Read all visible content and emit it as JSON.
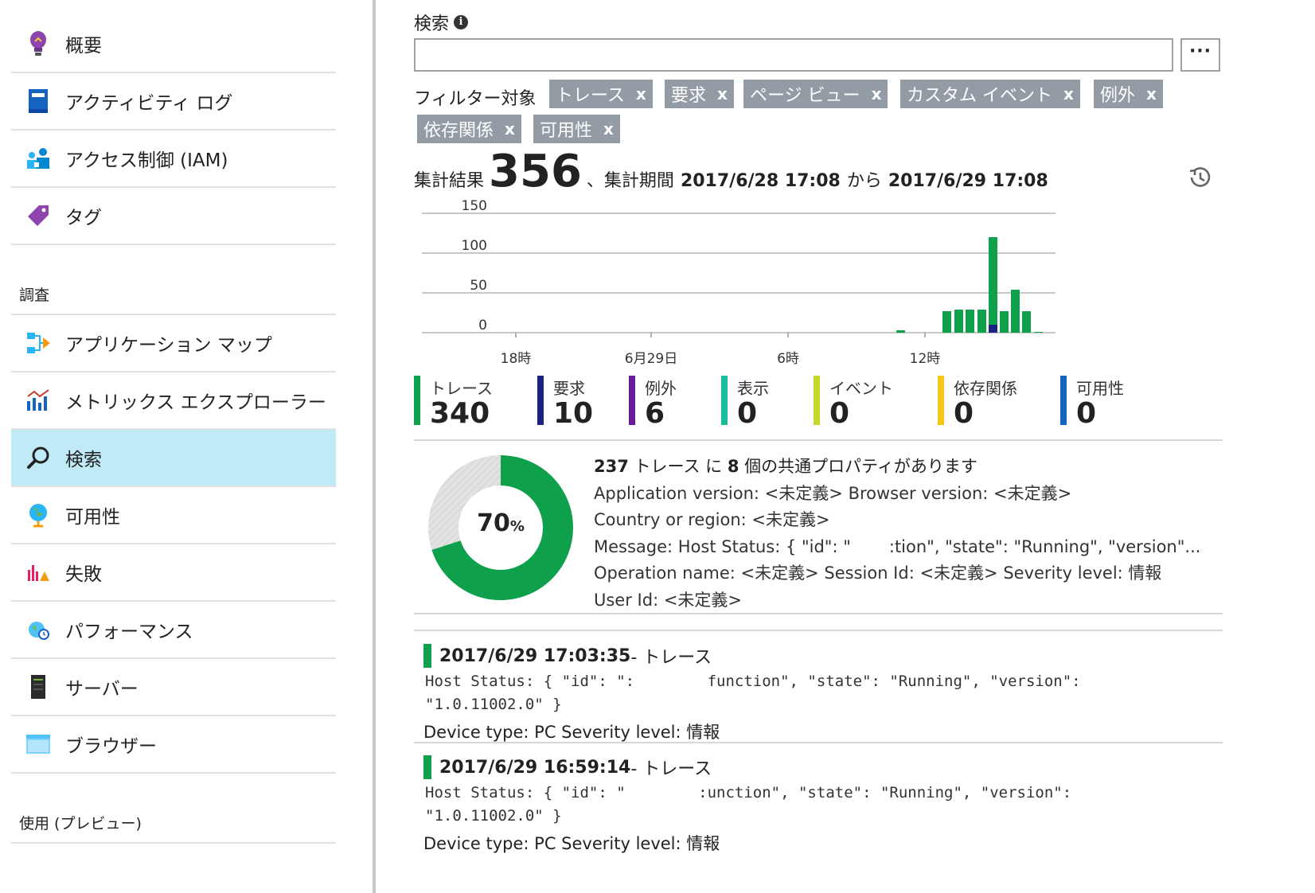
{
  "sidebar": {
    "items_top": [
      {
        "label": "概要",
        "icon": "lightbulb-icon"
      },
      {
        "label": "アクティビティ ログ",
        "icon": "activity-log-icon"
      },
      {
        "label": "アクセス制御 (IAM)",
        "icon": "iam-users-icon"
      },
      {
        "label": "タグ",
        "icon": "tag-icon"
      }
    ],
    "section_investigate": "調査",
    "items_investigate": [
      {
        "label": "アプリケーション マップ",
        "icon": "app-map-icon"
      },
      {
        "label": "メトリックス エクスプローラー",
        "icon": "metrics-chart-icon"
      },
      {
        "label": "検索",
        "icon": "search-icon",
        "active": true
      },
      {
        "label": "可用性",
        "icon": "globe-icon"
      },
      {
        "label": "失敗",
        "icon": "failures-icon"
      },
      {
        "label": "パフォーマンス",
        "icon": "performance-icon"
      },
      {
        "label": "サーバー",
        "icon": "server-icon"
      },
      {
        "label": "ブラウザー",
        "icon": "browser-icon"
      }
    ],
    "section_usage": "使用 (プレビュー)"
  },
  "search": {
    "label": "検索",
    "info_icon": "i",
    "value": "",
    "placeholder": "",
    "more_label": "···"
  },
  "filter": {
    "label": "フィルター対象",
    "chips": [
      "トレース",
      "要求",
      "ページ ビュー",
      "カスタム イベント",
      "例外",
      "依存関係",
      "可用性"
    ],
    "remove_glyph": "x"
  },
  "summary": {
    "prefix": "集計結果",
    "total": "356",
    "period_prefix": "、集計期間",
    "from": "2017/6/28 17:08",
    "mid": "から",
    "to": "2017/6/29 17:08"
  },
  "chart_data": {
    "type": "bar",
    "y_ticks": [
      "150",
      "100",
      "50",
      "0"
    ],
    "ylim": [
      0,
      150
    ],
    "x_ticks": [
      "18時",
      "6月29日",
      "6時",
      "12時"
    ],
    "grid": true,
    "colors": {
      "traces": "#0ea04a",
      "requests": "#1a237e"
    },
    "series": [
      {
        "name": "トレース",
        "values": [
          3,
          0,
          0,
          27,
          29,
          29,
          29,
          110,
          27,
          54,
          27,
          1
        ]
      },
      {
        "name": "要求",
        "values": [
          0,
          0,
          0,
          0,
          0,
          0,
          0,
          10,
          0,
          0,
          0,
          0
        ]
      }
    ]
  },
  "counts": [
    {
      "label": "トレース",
      "value": "340",
      "color": "#0ea04a"
    },
    {
      "label": "要求",
      "value": "10",
      "color": "#1a237e"
    },
    {
      "label": "例外",
      "value": "6",
      "color": "#6a1b9a"
    },
    {
      "label": "表示",
      "value": "0",
      "color": "#1abc9c"
    },
    {
      "label": "イベント",
      "value": "0",
      "color": "#c6d62a"
    },
    {
      "label": "依存関係",
      "value": "0",
      "color": "#f5c518"
    },
    {
      "label": "可用性",
      "value": "0",
      "color": "#1565c0"
    }
  ],
  "common": {
    "percent": 70,
    "percent_label": "70",
    "percent_unit": "%",
    "count": "237",
    "entity": "トレース",
    "mid": "に",
    "props_count": "8",
    "suffix": "個の共通プロパティがあります",
    "lines": [
      [
        "Application version: <未定義>",
        "Browser version: <未定義>"
      ],
      [
        "Country or region: <未定義>"
      ],
      [
        "Message: Host Status: { \"id\": \"",
        ":tion\", \"state\": \"Running\", \"version\"..."
      ],
      [
        "Operation name: <未定義>",
        "Session Id: <未定義>",
        "Severity level: 情報"
      ],
      [
        "User Id: <未定義>"
      ]
    ]
  },
  "results": [
    {
      "timestamp": "2017/6/29 17:03:35",
      "type": " - トレース",
      "code_line1": "Host Status: { \"id\": \":        function\", \"state\": \"Running\", \"version\":",
      "code_line2": "\"1.0.11002.0\" }",
      "device": "Device type: PC",
      "severity": "Severity level: 情報"
    },
    {
      "timestamp": "2017/6/29 16:59:14",
      "type": " - トレース",
      "code_line1": "Host Status: { \"id\": \"        :unction\", \"state\": \"Running\", \"version\":",
      "code_line2": "\"1.0.11002.0\" }",
      "device": "Device type: PC",
      "severity": "Severity level: 情報"
    }
  ]
}
